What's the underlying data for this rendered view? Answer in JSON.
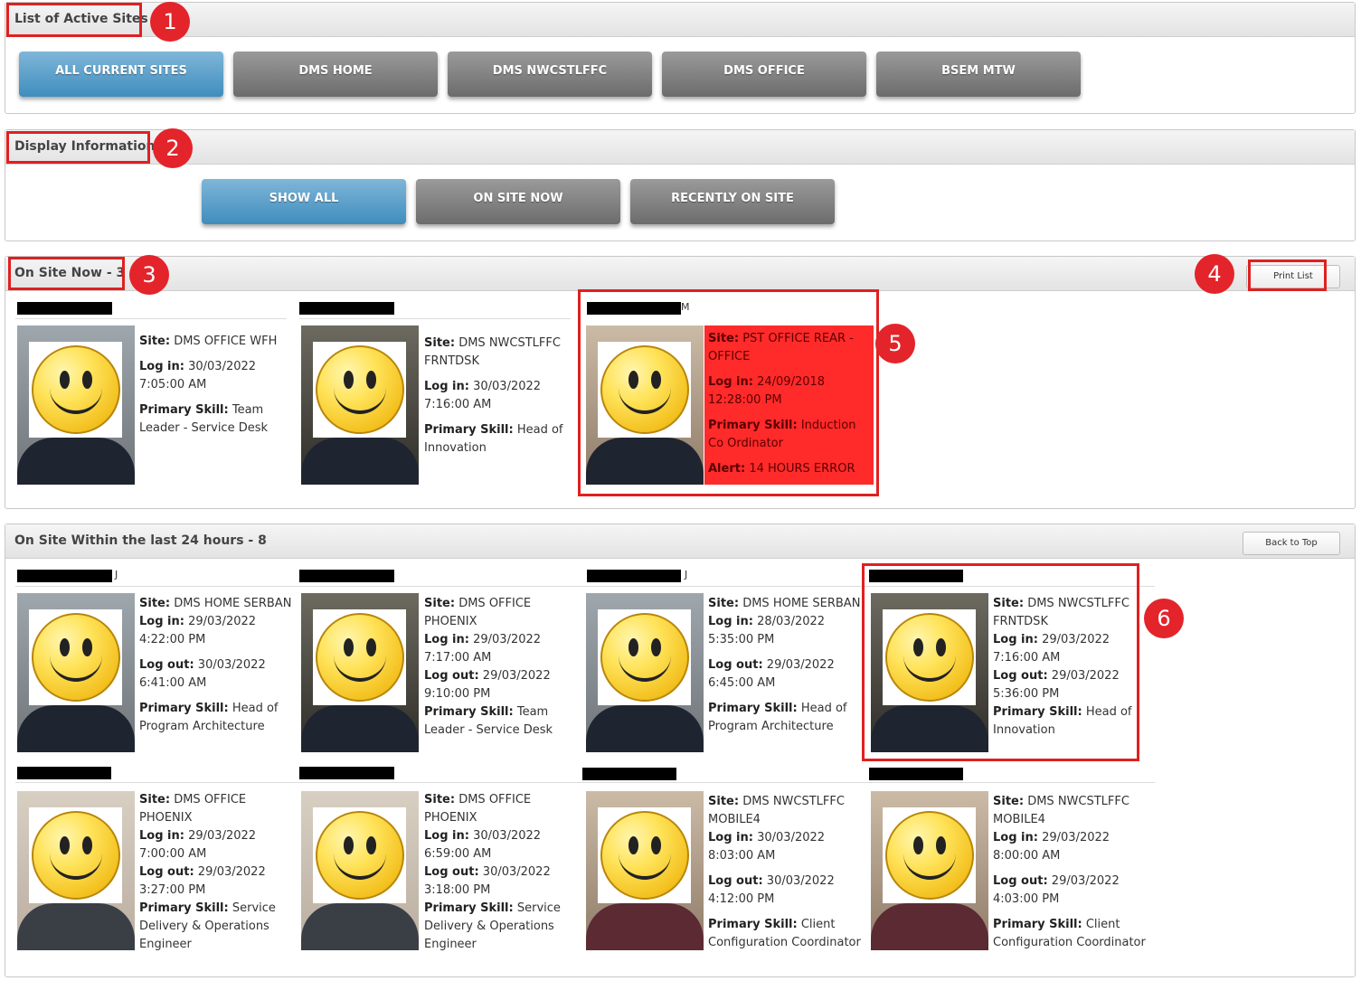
{
  "sites_panel": {
    "title": "List of Active Sites",
    "marker": "1",
    "buttons": [
      "ALL CURRENT SITES",
      "DMS HOME",
      "DMS NWCSTLFFC",
      "DMS OFFICE",
      "BSEM MTW"
    ]
  },
  "display_panel": {
    "title": "Display Information",
    "marker": "2",
    "buttons": [
      "SHOW ALL",
      "ON SITE NOW",
      "RECENTLY ON SITE"
    ]
  },
  "onsite_panel": {
    "title": "On Site Now - 3",
    "marker": "3",
    "print_marker": "4",
    "print_label": "Print List",
    "alert_marker": "5",
    "people": [
      {
        "name_suffix": "",
        "site": "DMS OFFICE WFH",
        "login": "30/03/2022 7:05:00 AM",
        "skill": "Team Leader - Service Desk"
      },
      {
        "name_suffix": "",
        "site": "DMS NWCSTLFFC FRNTDSK",
        "login": "30/03/2022 7:16:00 AM",
        "skill": "Head of Innovation"
      },
      {
        "name_suffix": "M",
        "site": "PST OFFICE REAR - OFFICE",
        "login": "24/09/2018 12:28:00 PM",
        "skill": "Induction Co Ordinator",
        "alert": "14 HOURS ERROR"
      }
    ]
  },
  "recent_panel": {
    "title": "On Site Within the last 24 hours - 8",
    "back_label": "Back to Top",
    "marker": "6",
    "people": [
      {
        "name_suffix": "J",
        "site": "DMS HOME SERBAN",
        "login": "29/03/2022 4:22:00 PM",
        "logout": "30/03/2022 6:41:00 AM",
        "skill": "Head of Program Architecture"
      },
      {
        "name_suffix": "",
        "site": "DMS OFFICE PHOENIX",
        "login": "29/03/2022 7:17:00 AM",
        "logout": "29/03/2022 9:10:00 PM",
        "skill": "Team Leader - Service Desk"
      },
      {
        "name_suffix": "J",
        "site": "DMS HOME SERBAN",
        "login": "28/03/2022 5:35:00 PM",
        "logout": "29/03/2022 6:45:00 AM",
        "skill": "Head of Program Architecture"
      },
      {
        "name_suffix": "",
        "site": "DMS NWCSTLFFC FRNTDSK",
        "login": "29/03/2022 7:16:00 AM",
        "logout": "29/03/2022 5:36:00 PM",
        "skill": "Head of Innovation"
      },
      {
        "name_suffix": "",
        "site": "DMS OFFICE PHOENIX",
        "login": "29/03/2022 7:00:00 AM",
        "logout": "29/03/2022 3:27:00 PM",
        "skill": "Service Delivery & Operations Engineer"
      },
      {
        "name_suffix": "",
        "site": "DMS OFFICE PHOENIX",
        "login": "30/03/2022 6:59:00 AM",
        "logout": "30/03/2022 3:18:00 PM",
        "skill": "Service Delivery & Operations Engineer"
      },
      {
        "name_suffix": "",
        "site": "DMS NWCSTLFFC MOBILE4",
        "login": "30/03/2022 8:03:00 AM",
        "logout": "30/03/2022 4:12:00 PM",
        "skill": "Client Configuration Coordinator"
      },
      {
        "name_suffix": "",
        "site": "DMS NWCSTLFFC MOBILE4",
        "login": "29/03/2022 8:00:00 AM",
        "logout": "29/03/2022 4:03:00 PM",
        "skill": "Client Configuration Coordinator"
      }
    ]
  },
  "labels": {
    "site": "Site:",
    "login": "Log in:",
    "logout": "Log out:",
    "skill": "Primary Skill:",
    "alert": "Alert:"
  },
  "colors": {
    "active_button": "#4a94c4",
    "inactive_button": "#7a7a7a",
    "alert_card": "#ff2a2a",
    "annotation_red": "#e3242b"
  }
}
